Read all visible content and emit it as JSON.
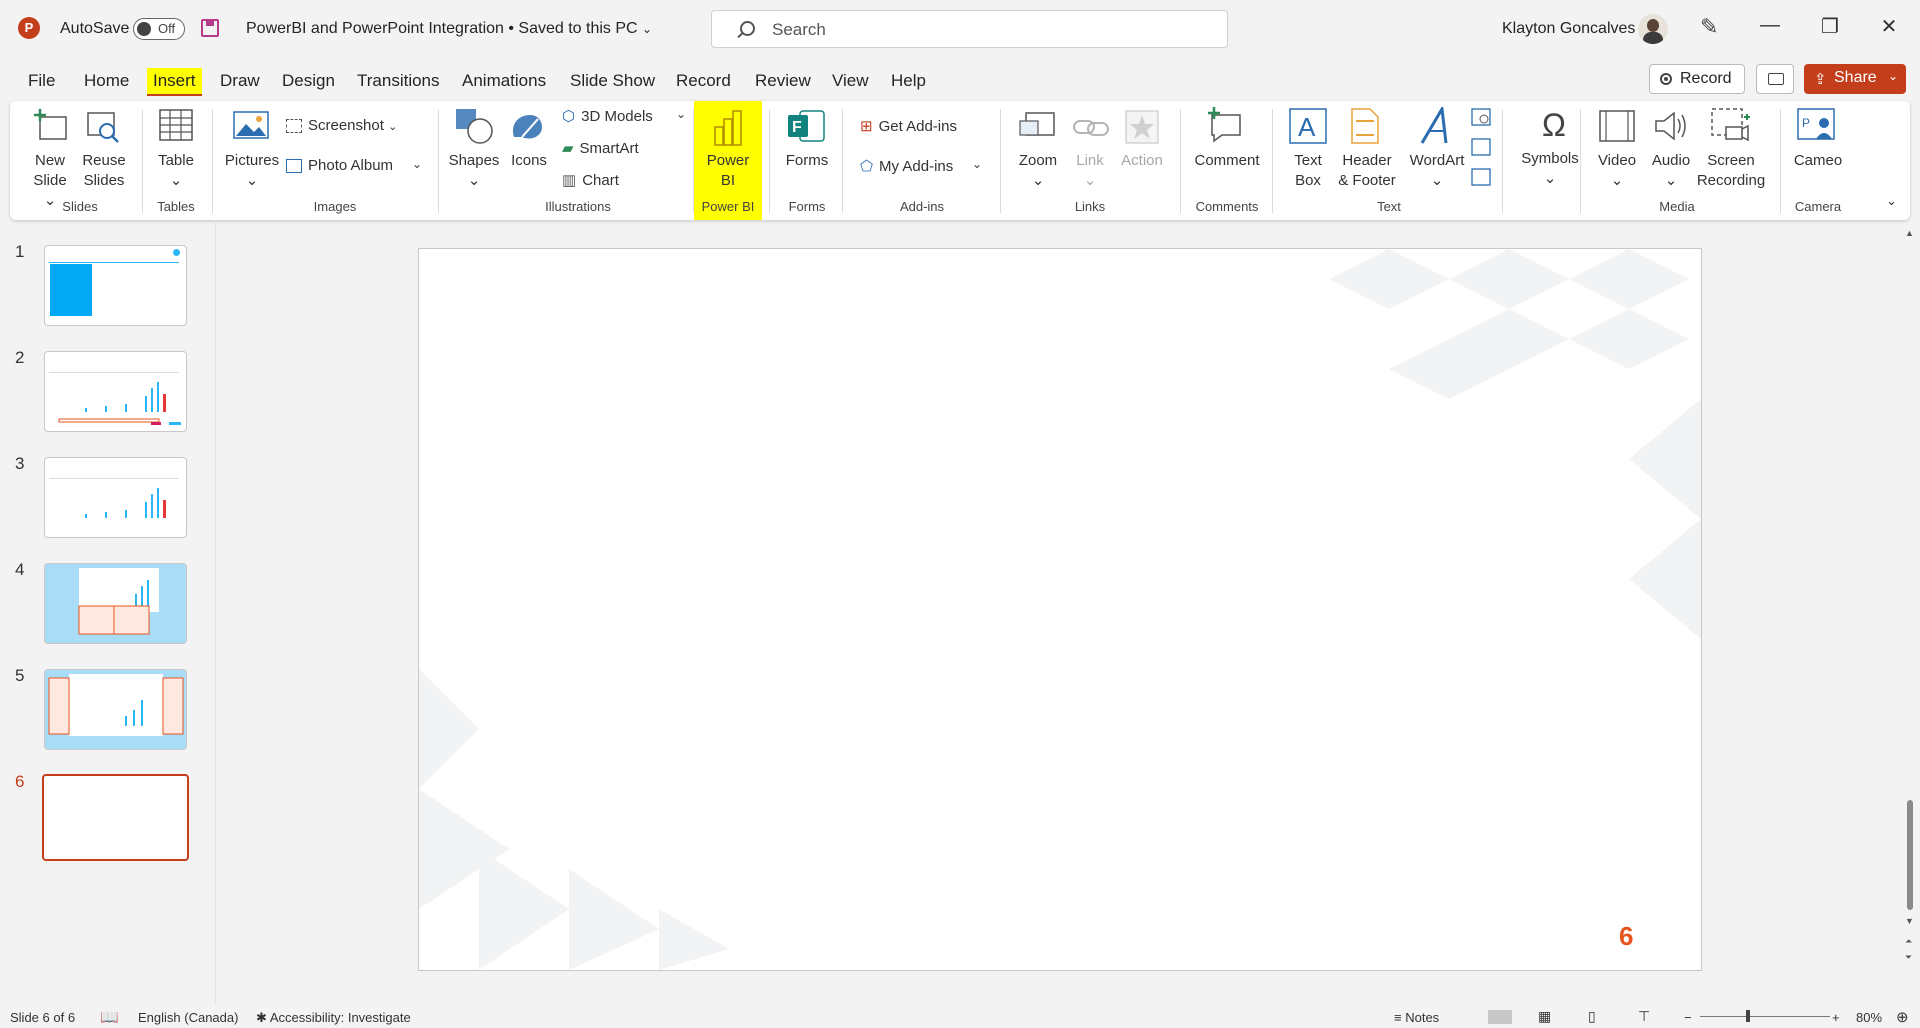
{
  "titlebar": {
    "app_logo": "P",
    "autosave_label": "AutoSave",
    "autosave_state": "Off",
    "document_title": "PowerBI and PowerPoint Integration • Saved to this PC",
    "search_placeholder": "Search",
    "user_name": "Klayton Goncalves",
    "minimize": "—",
    "restore": "❐",
    "close": "✕"
  },
  "menu": {
    "tabs": [
      "File",
      "Home",
      "Insert",
      "Draw",
      "Design",
      "Transitions",
      "Animations",
      "Slide Show",
      "Record",
      "Review",
      "View",
      "Help"
    ],
    "active_tab": "Insert",
    "record_label": "Record",
    "share_label": "Share"
  },
  "ribbon": {
    "slides": {
      "label": "Slides",
      "new_slide": [
        "New",
        "Slide ⌄"
      ],
      "reuse_slides": [
        "Reuse",
        "Slides"
      ]
    },
    "tables": {
      "label": "Tables",
      "table": "Table"
    },
    "images": {
      "label": "Images",
      "pictures": "Pictures",
      "screenshot": "Screenshot",
      "photo_album": "Photo Album"
    },
    "illustrations": {
      "label": "Illustrations",
      "shapes": "Shapes",
      "icons": "Icons",
      "models": "3D Models",
      "smartart": "SmartArt",
      "chart": "Chart"
    },
    "powerbi": {
      "label": "Power BI",
      "button": [
        "Power",
        "BI"
      ]
    },
    "forms": {
      "label": "Forms",
      "button": "Forms"
    },
    "addins": {
      "label": "Add-ins",
      "get": "Get Add-ins",
      "my": "My Add-ins"
    },
    "links": {
      "label": "Links",
      "zoom": "Zoom",
      "link": "Link",
      "action": "Action"
    },
    "comments": {
      "label": "Comments",
      "comment": "Comment"
    },
    "text": {
      "label": "Text",
      "textbox": [
        "Text",
        "Box"
      ],
      "header": [
        "Header",
        "& Footer"
      ],
      "wordart": "WordArt"
    },
    "symbols": {
      "label": "",
      "symbols": "Symbols"
    },
    "media": {
      "label": "Media",
      "video": "Video",
      "audio": "Audio",
      "screen_recording": [
        "Screen",
        "Recording"
      ]
    },
    "camera": {
      "label": "Camera",
      "cameo": "Cameo"
    }
  },
  "thumbnails": {
    "numbers": [
      "1",
      "2",
      "3",
      "4",
      "5",
      "6"
    ],
    "selected": "6"
  },
  "slide": {
    "number": "6"
  },
  "status": {
    "slide_info": "Slide 6 of 6",
    "language": "English (Canada)",
    "accessibility": "Accessibility: Investigate",
    "notes": "Notes",
    "zoom": "80%"
  },
  "colors": {
    "accent": "#c43e1c",
    "highlight": "#ffff00",
    "slide_number": "#e9531f"
  }
}
